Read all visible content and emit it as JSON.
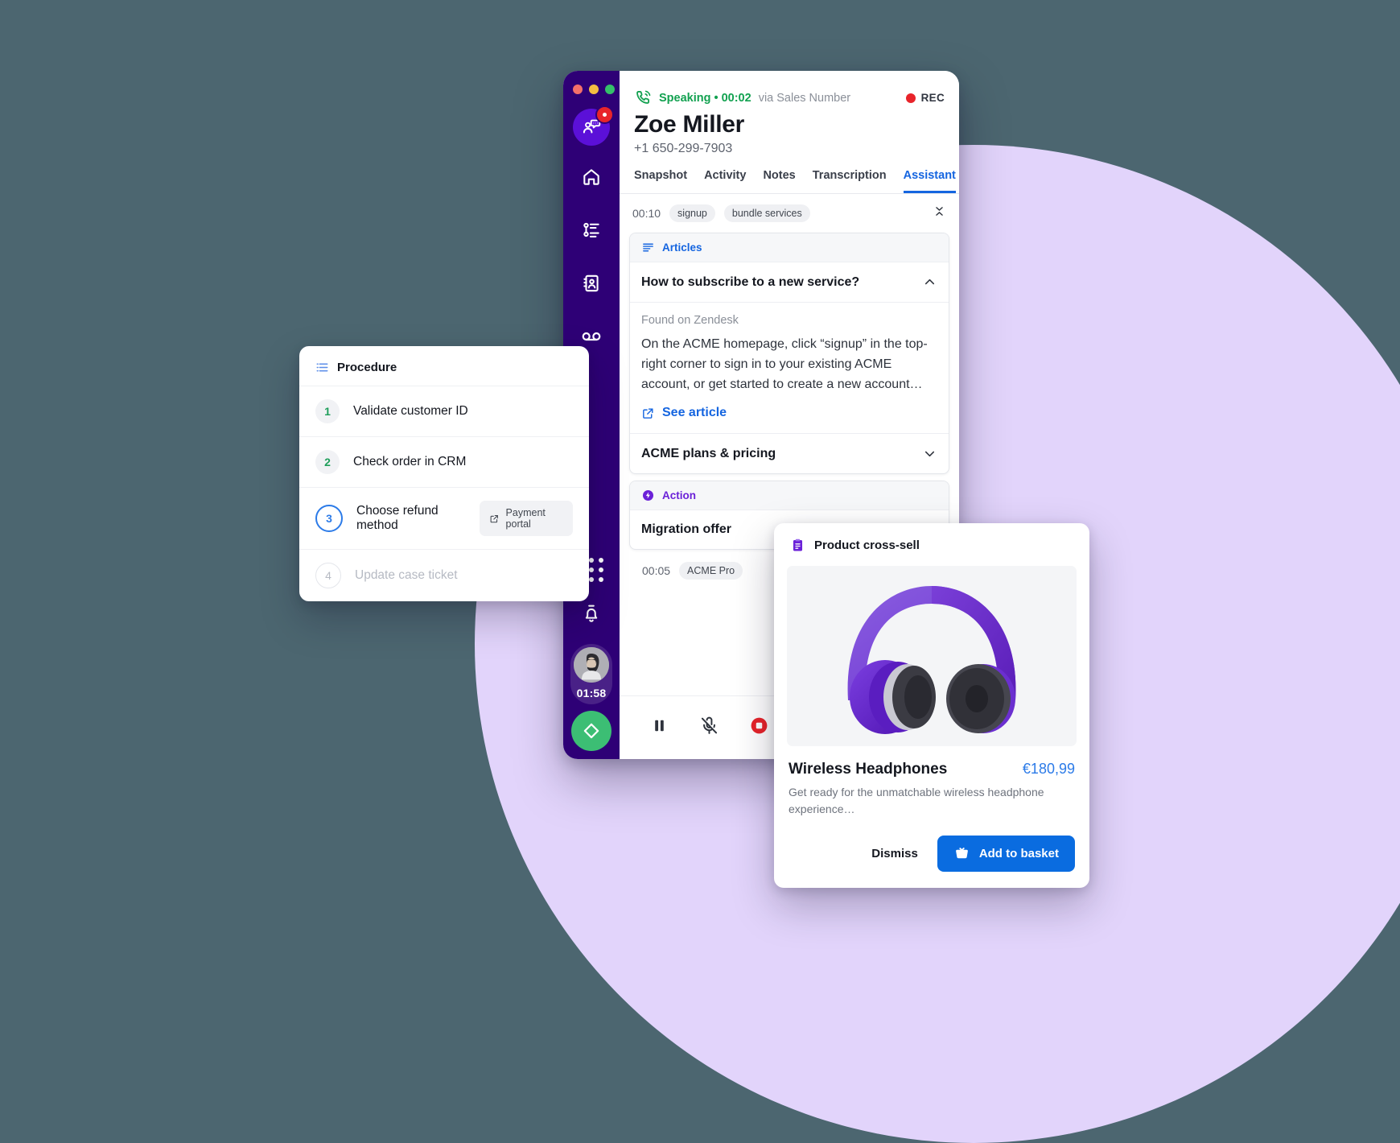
{
  "theme": {
    "page_background": "#4C6670",
    "blob": "#E2D4FB",
    "sidebar": "#2E0076",
    "accent_blue": "#1565E0",
    "accent_purple": "#6B21D8",
    "status_green": "#12A150",
    "record_red": "#E8242A"
  },
  "window_controls": {
    "close": "#F4706A",
    "minimize": "#F5BE41",
    "maximize": "#35C06A"
  },
  "sidebar": {
    "items": [
      {
        "name": "agent-status-avatar",
        "icon": "agent-chat-icon",
        "badge": true
      },
      {
        "name": "home",
        "icon": "home-icon"
      },
      {
        "name": "queues",
        "icon": "flow-list-icon"
      },
      {
        "name": "contacts",
        "icon": "contact-book-icon"
      },
      {
        "name": "voicemail",
        "icon": "voicemail-icon"
      }
    ],
    "bottom": {
      "dialpad_icon": "dialpad-icon",
      "notifications_icon": "bell-icon",
      "agent_timer": "01:58",
      "action_icon": "diamond-icon"
    }
  },
  "call_header": {
    "phone_icon": "phone-in-talk-icon",
    "status": "Speaking • 00:02",
    "via": "via Sales Number",
    "rec_label": "REC",
    "caller_name": "Zoe Miller",
    "caller_phone": "+1 650-299-7903"
  },
  "tabs": [
    {
      "label": "Snapshot",
      "active": false
    },
    {
      "label": "Activity",
      "active": false
    },
    {
      "label": "Notes",
      "active": false
    },
    {
      "label": "Transcription",
      "active": false
    },
    {
      "label": "Assistant",
      "active": true
    }
  ],
  "timeline": [
    {
      "time": "00:10",
      "chips": [
        "signup",
        "bundle services"
      ],
      "collapse_icon": "collapse-icon"
    },
    {
      "time": "00:05",
      "chips": [
        "ACME Pro"
      ]
    }
  ],
  "articles_card": {
    "header_icon": "articles-icon",
    "header_label": "Articles",
    "items": [
      {
        "title": "How to subscribe to a new service?",
        "expanded": true,
        "chevron": "chevron-up-icon",
        "source": "Found on Zendesk",
        "excerpt": "On the ACME homepage, click “signup” in the top-right corner to sign in to your existing ACME account, or get started to create a new account…",
        "link_label": "See article",
        "link_icon": "external-link-icon"
      },
      {
        "title": "ACME plans & pricing",
        "expanded": false,
        "chevron": "chevron-down-icon"
      }
    ]
  },
  "action_card": {
    "header_icon": "lightning-icon",
    "header_label": "Action",
    "title": "Migration offer"
  },
  "call_controls": [
    {
      "name": "pause-call-button",
      "icon": "pause-icon"
    },
    {
      "name": "mute-microphone-button",
      "icon": "mic-off-icon"
    },
    {
      "name": "stop-recording-button",
      "icon": "stop-record-icon"
    },
    {
      "name": "more-options-button",
      "icon": "more-vertical-icon"
    }
  ],
  "procedure_card": {
    "header_icon": "checklist-icon",
    "title": "Procedure",
    "steps": [
      {
        "number": "1",
        "label": "Validate customer ID",
        "state": "done"
      },
      {
        "number": "2",
        "label": "Check order in CRM",
        "state": "done"
      },
      {
        "number": "3",
        "label": "Choose refund method",
        "state": "active",
        "button": {
          "label": "Payment portal",
          "icon": "external-link-icon"
        }
      },
      {
        "number": "4",
        "label": "Update case ticket",
        "state": "todo"
      }
    ]
  },
  "crosssell_card": {
    "header_icon": "clipboard-icon",
    "header_label": "Product cross-sell",
    "product_image_alt": "purple-wireless-headphones",
    "product_name": "Wireless Headphones",
    "price": "€180,99",
    "description": "Get ready for the unmatchable wireless headphone experience…",
    "dismiss_label": "Dismiss",
    "add_label": "Add to basket",
    "add_icon": "basket-icon"
  }
}
